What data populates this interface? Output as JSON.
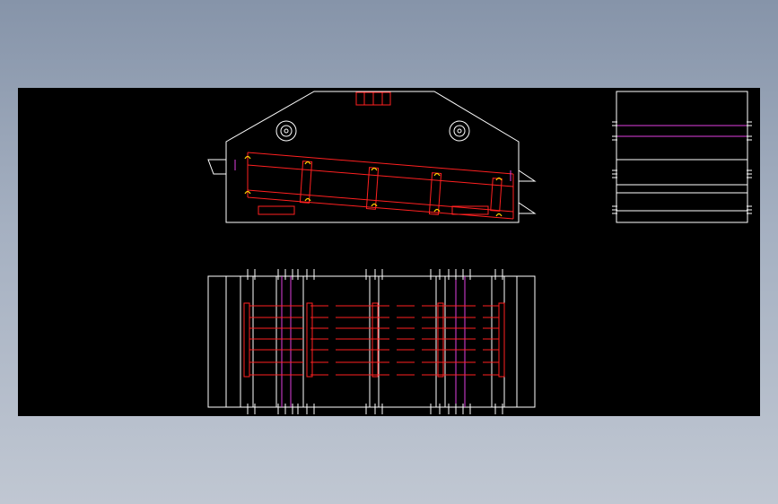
{
  "drawing": {
    "background": "#000000",
    "colors": {
      "outline": "#ffffff",
      "screen_deck": "#ff2020",
      "spring_bolts": "#ffd000",
      "center_lines": "#e040e0"
    },
    "views": [
      "side-elevation",
      "end-view",
      "plan-view"
    ]
  }
}
